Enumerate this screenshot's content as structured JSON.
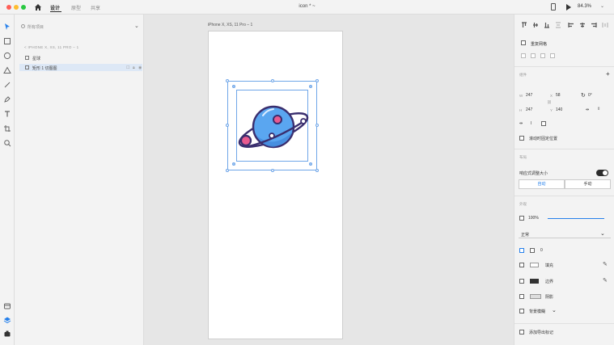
{
  "titlebar": {
    "tabs": [
      "设计",
      "原型",
      "共享"
    ],
    "doc_title": "icon * ~",
    "zoom": "84.3%",
    "zoom_chevron": "⌄"
  },
  "layers": {
    "search_placeholder": "所有项目",
    "breadcrumb": "< IPHONE X, XS, 11 PRO – 1",
    "rows": [
      {
        "label": "星球"
      },
      {
        "label": "矩形 1 切图图"
      }
    ]
  },
  "canvas": {
    "artboard_label": "iPhone X, XS, 11 Pro – 1"
  },
  "props": {
    "repeat_grid": "重复网格",
    "component_header": "组件",
    "plus": "+",
    "w_label": "W",
    "w_value": "247",
    "x_label": "X",
    "x_value": "58",
    "rotation": "0°",
    "h_label": "H",
    "h_value": "247",
    "y_label": "Y",
    "y_value": "140",
    "fix_position": "滚动时固定位置",
    "layout_header": "布局",
    "responsive": "响应式调整大小",
    "seg_auto": "自动",
    "seg_manual": "手动",
    "appearance_header": "外观",
    "opacity": "100%",
    "blend_mode": "正常",
    "corner_value": "0",
    "fill": "填充",
    "border": "边界",
    "shadow": "阴影",
    "bg_blur": "背景模糊",
    "export_mark": "添加导出标记"
  },
  "colors": {
    "accent": "#2680eb",
    "selection": "#6fa6e8",
    "planet_blue": "#5aa6f0",
    "planet_outline": "#3a2e6e",
    "planet_pink": "#e85a8f"
  }
}
